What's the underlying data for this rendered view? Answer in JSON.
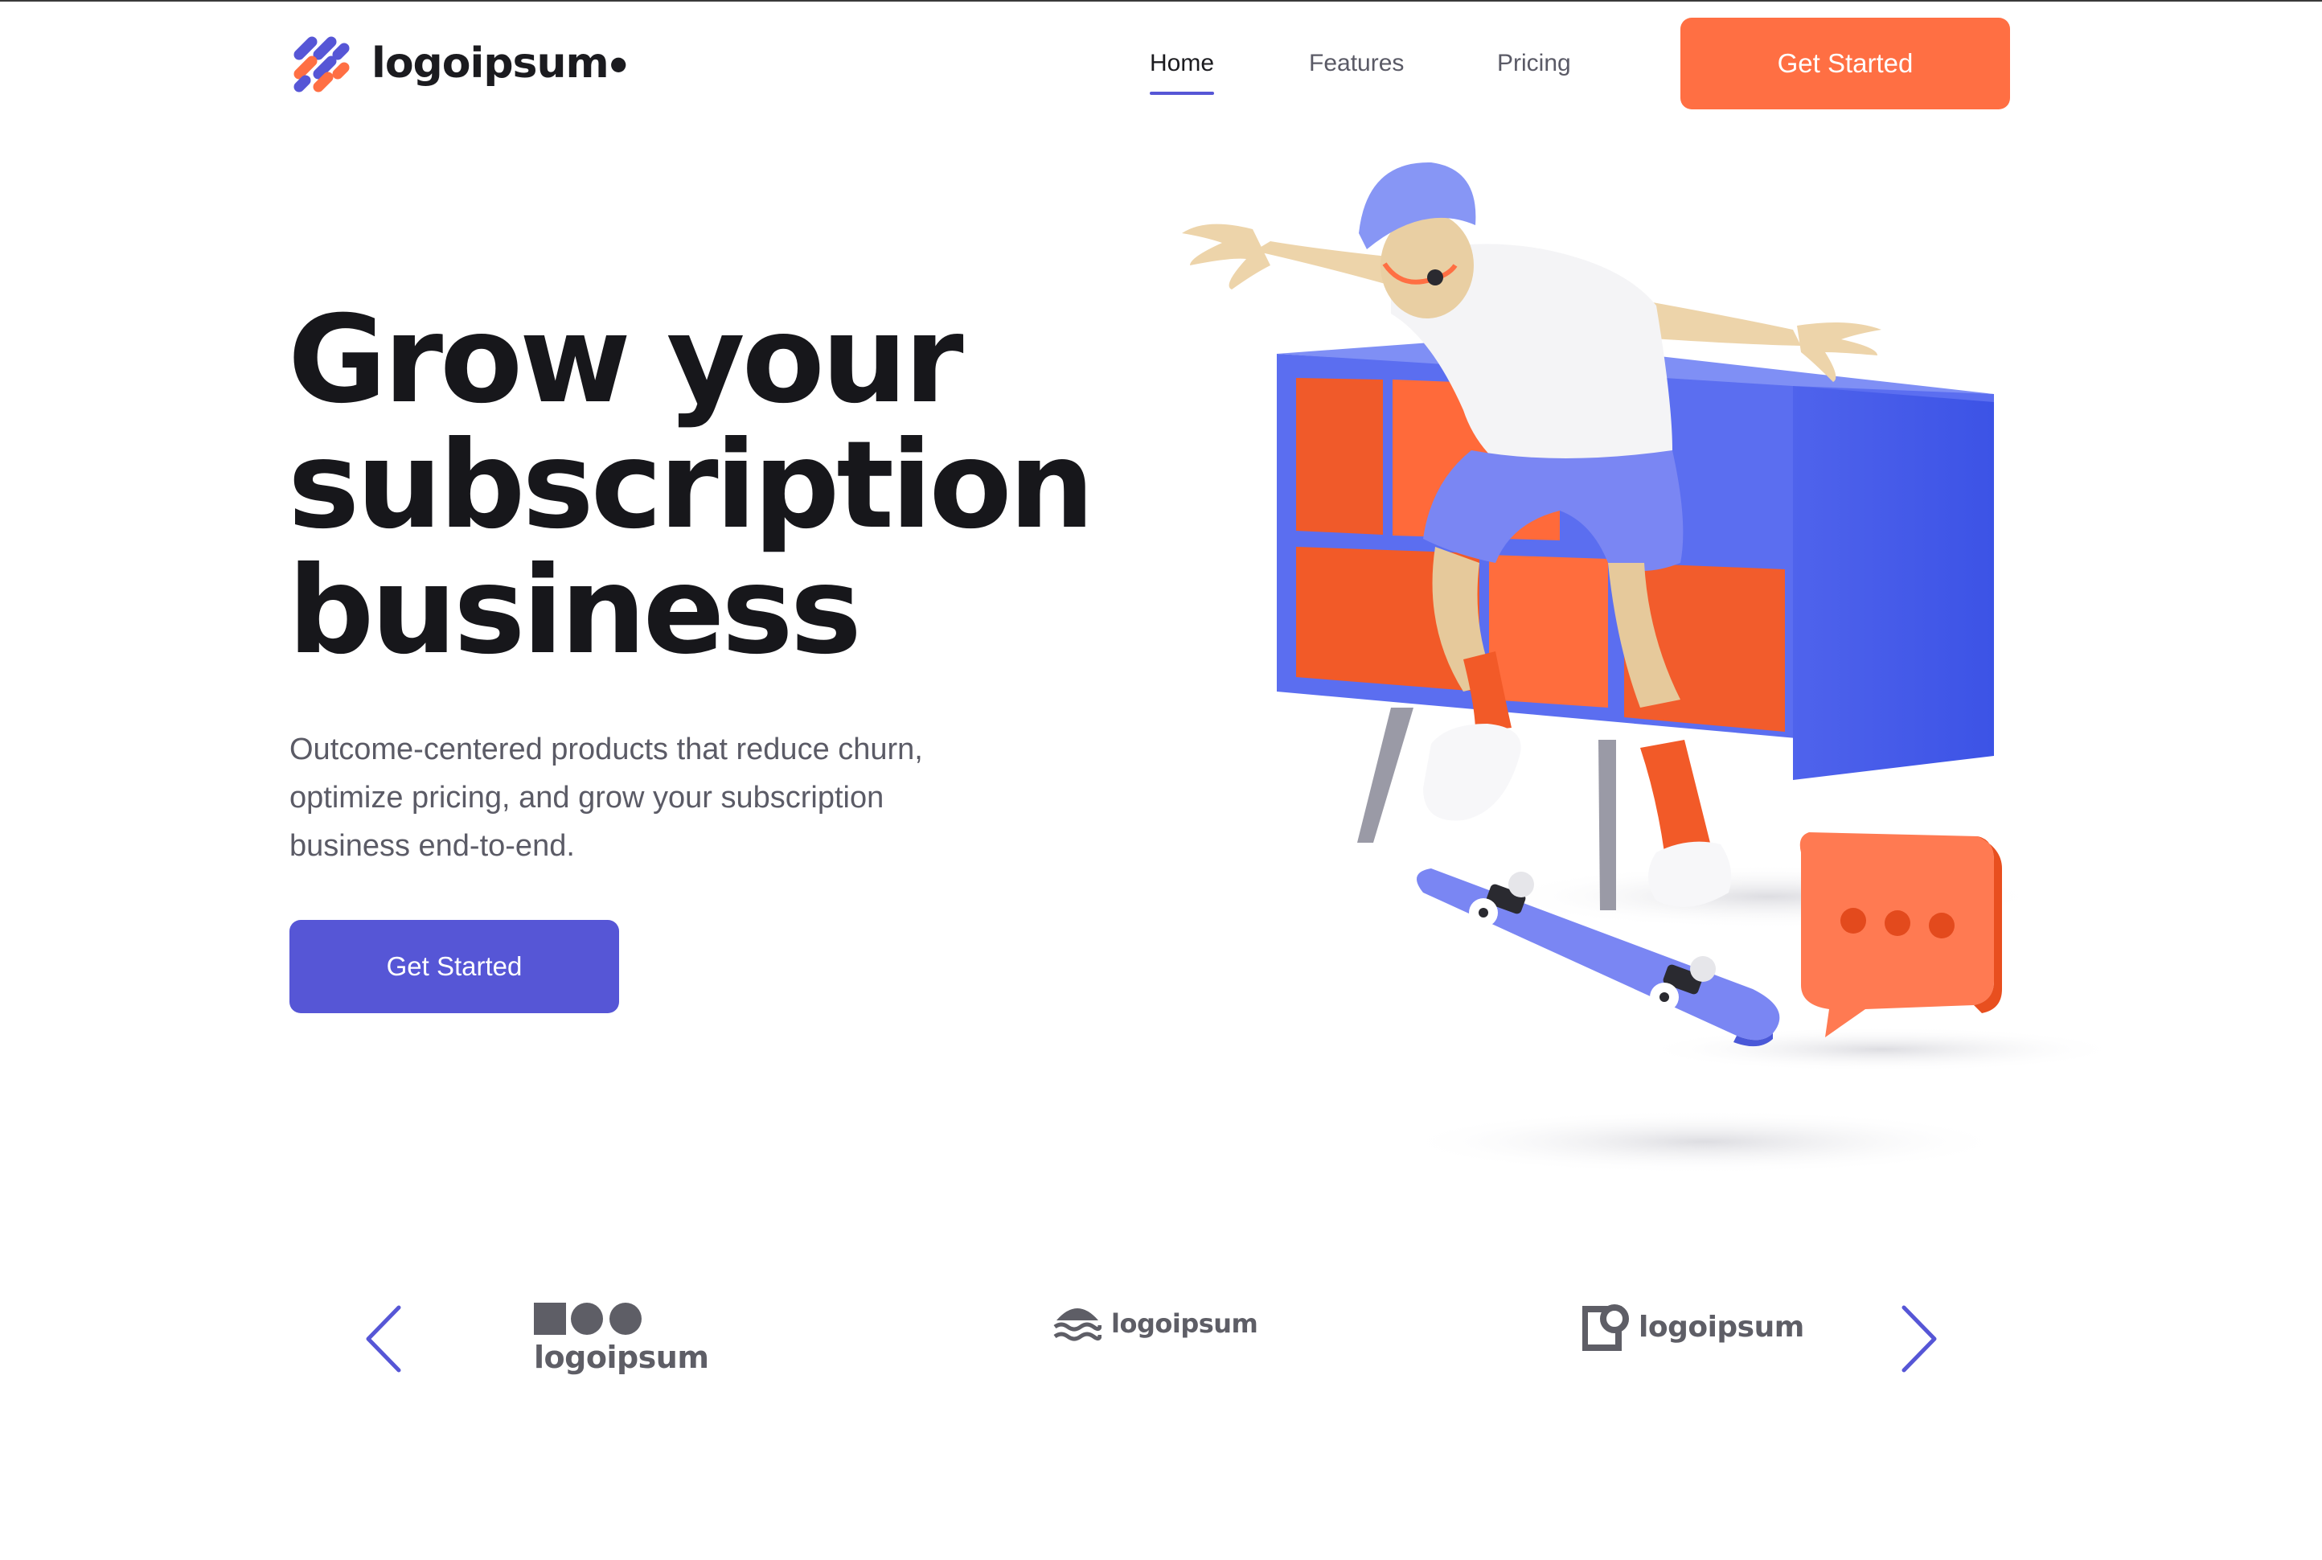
{
  "brand": {
    "name": "logoipsum",
    "colors": {
      "orange": "#ff6f43",
      "purple": "#5656d6",
      "text": "#17171b",
      "muted": "#5b5b66"
    }
  },
  "nav": {
    "items": [
      {
        "label": "Home",
        "active": true
      },
      {
        "label": "Features",
        "active": false
      },
      {
        "label": "Pricing",
        "active": false
      }
    ],
    "cta_label": "Get Started"
  },
  "hero": {
    "title_lines": [
      "Grow your",
      "subscription",
      "business"
    ],
    "subtitle_lines": [
      "Outcome-centered products that reduce churn,",
      "optimize pricing, and grow your subscription",
      "business end-to-end."
    ],
    "cta_label": "Get Started"
  },
  "illustration": {
    "description_icon": "skateboarder-3d-illustration",
    "chat_bubble_icon": "chat-bubble-icon"
  },
  "partners": {
    "prev_icon": "chevron-left-icon",
    "next_icon": "chevron-right-icon",
    "logos": [
      {
        "name": "logoipsum",
        "icon": "shapes-logo-icon"
      },
      {
        "name": "logoipsum",
        "icon": "waves-logo-icon"
      },
      {
        "name": "logoipsum",
        "icon": "square-circle-logo-icon"
      }
    ]
  }
}
